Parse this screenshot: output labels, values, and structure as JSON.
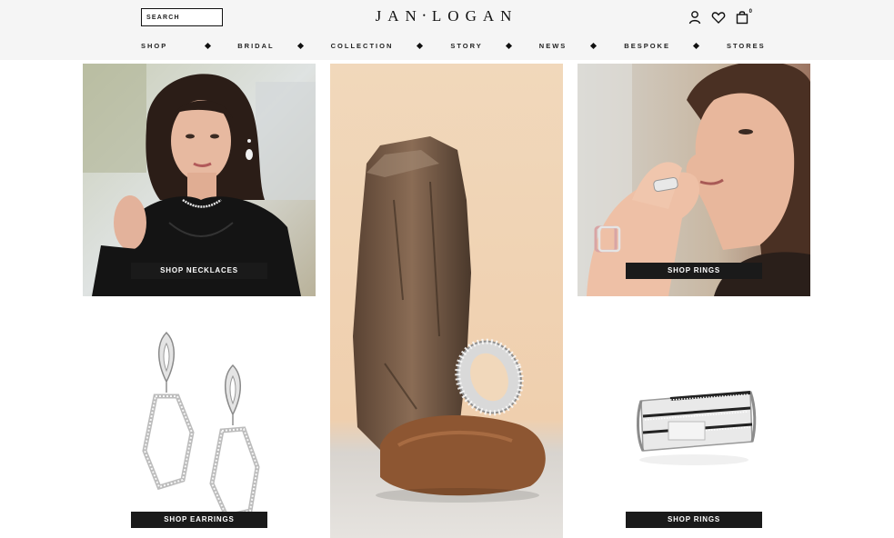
{
  "header": {
    "search_placeholder": "SEARCH",
    "logo_left": "JAN",
    "logo_right": "LOGAN",
    "cart_count": "0",
    "icons": [
      "user-icon",
      "heart-icon",
      "bag-icon"
    ]
  },
  "nav": {
    "items": [
      {
        "label": "SHOP"
      },
      {
        "label": "BRIDAL"
      },
      {
        "label": "COLLECTION"
      },
      {
        "label": "STORY"
      },
      {
        "label": "NEWS"
      },
      {
        "label": "BESPOKE"
      },
      {
        "label": "STORES"
      }
    ]
  },
  "tiles": {
    "necklaces": {
      "button": "SHOP NECKLACES"
    },
    "rings_model": {
      "button": "SHOP RINGS"
    },
    "earrings": {
      "button": "SHOP EARRINGS"
    },
    "ring_product": {
      "button": "SHOP RINGS"
    }
  },
  "colors": {
    "header_bg": "#f5f5f5",
    "button_bg": "#1a1a1a",
    "center_bg": "#efd3b3"
  }
}
